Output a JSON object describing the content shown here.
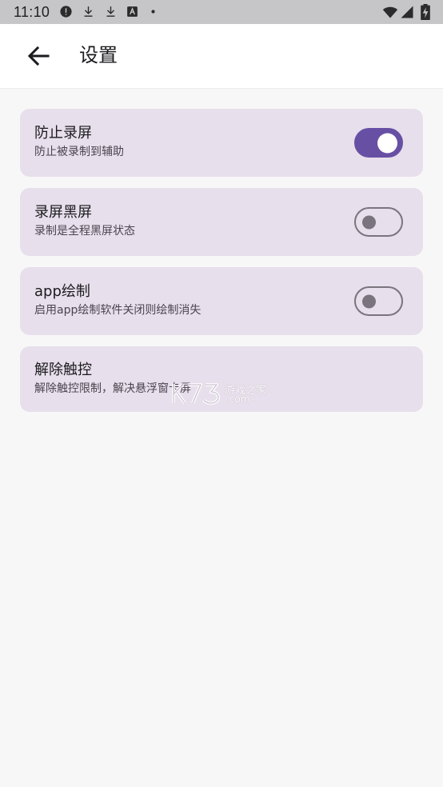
{
  "status_bar": {
    "time": "11:10",
    "icons": [
      "alert-icon",
      "download-icon",
      "download-icon",
      "a-box-icon",
      "dot-icon",
      "wifi-icon",
      "signal-icon",
      "battery-charging-icon"
    ]
  },
  "app_bar": {
    "back_icon": "arrow-left-icon",
    "title": "设置"
  },
  "settings": [
    {
      "title": "防止录屏",
      "subtitle": "防止被录制到辅助",
      "switch": true
    },
    {
      "title": "录屏黑屏",
      "subtitle": "录制是全程黑屏状态",
      "switch": false
    },
    {
      "title": "app绘制",
      "subtitle": "启用app绘制软件关闭则绘制消失",
      "switch": false
    },
    {
      "title": "解除触控",
      "subtitle": "解除触控限制，解决悬浮窗卡屏"
    }
  ],
  "watermark": {
    "text": "游戏之家",
    "sub": ".com"
  },
  "colors": {
    "accent": "#6750a4",
    "card_bg": "#e7dfeb",
    "page_bg": "#f8f7f8",
    "status_bar_bg": "#c6c6c8"
  }
}
